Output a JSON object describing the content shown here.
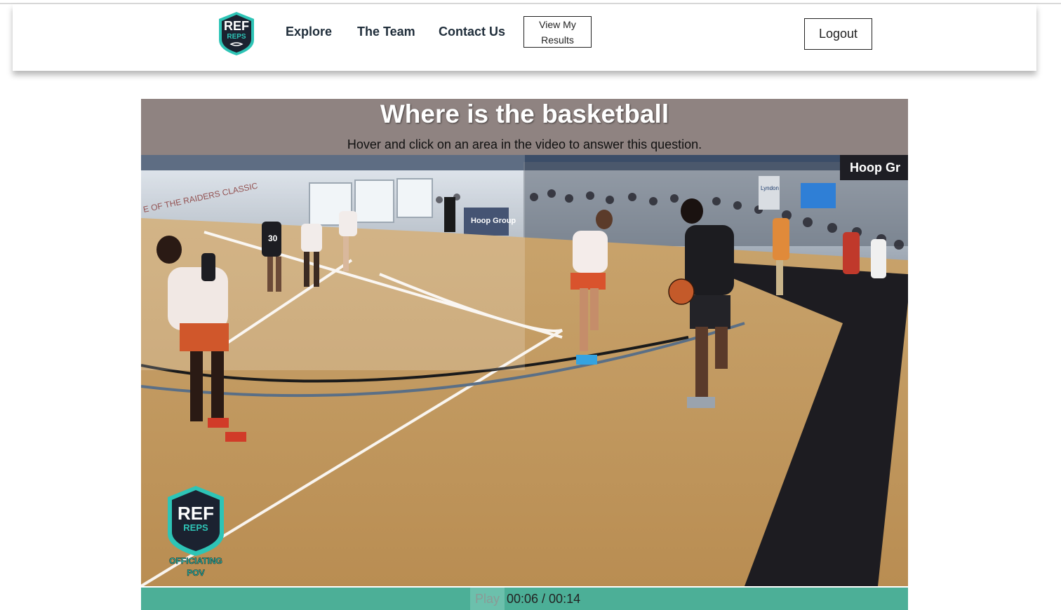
{
  "nav": {
    "logo_text_top": "REF",
    "logo_text_bottom": "REPS",
    "links": [
      "Explore",
      "The Team",
      "Contact Us"
    ],
    "results_button": {
      "line1": "View My",
      "line2": "Results"
    },
    "logout_label": "Logout"
  },
  "question": {
    "title": "Where is the basketball",
    "instruction": "Hover and click on an area in the video to answer this question."
  },
  "video": {
    "banner_text": "E OF THE RAIDERS CLASSIC",
    "hoop_group_text": "Hoop Group",
    "hoop_group_banner": "Hoop Gr",
    "sponsor_text": "Lyndon",
    "watermark": {
      "top": "REF",
      "middle": "REPS",
      "line1": "OFFICIATING",
      "line2": "POV"
    },
    "jersey_numbers": [
      "30"
    ]
  },
  "controls": {
    "play_label": "Play",
    "time": "00:06 / 00:14"
  },
  "colors": {
    "question_bg": "#8f8381",
    "controls_bg": "#4caf97",
    "logo_teal": "#2ec4b6",
    "logo_dark": "#1b2230"
  }
}
